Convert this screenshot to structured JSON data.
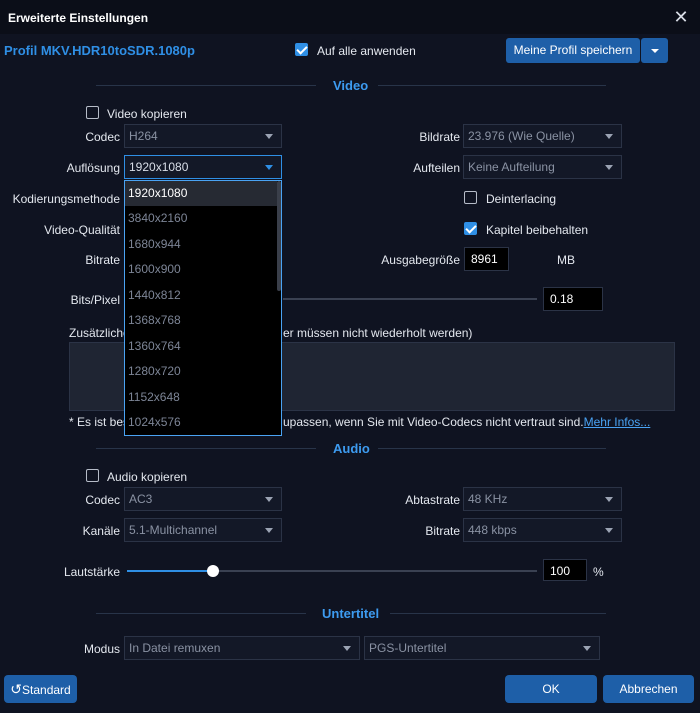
{
  "window": {
    "title": "Erweiterte Einstellungen",
    "close_glyph": "✕"
  },
  "profile": {
    "name": "Profil MKV.HDR10toSDR.1080p",
    "apply_all_label": "Auf alle anwenden",
    "apply_all_checked": true,
    "save_label": "Meine Profil speichern"
  },
  "video": {
    "section_title": "Video",
    "copy_label": "Video kopieren",
    "codec": {
      "label": "Codec",
      "value": "H264"
    },
    "resolution": {
      "label": "Auflösung",
      "value": "1920x1080",
      "options": [
        "1920x1080",
        "3840x2160",
        "1680x944",
        "1600x900",
        "1440x812",
        "1368x768",
        "1360x764",
        "1280x720",
        "1152x648",
        "1024x576"
      ],
      "selected_index": 0
    },
    "encoding_label": "Kodierungsmethode",
    "quality_label": "Video-Qualität",
    "bitrate_label": "Bitrate",
    "bits_pixel": {
      "label": "Bits/Pixel",
      "value": "0.18"
    },
    "framerate": {
      "label": "Bildrate",
      "value": "23.976 (Wie Quelle)"
    },
    "split": {
      "label": "Aufteilen",
      "value": "Keine Aufteilung"
    },
    "deinterlacing": {
      "label": "Deinterlacing",
      "checked": false
    },
    "chapters": {
      "label": "Kapitel beibehalten",
      "checked": true
    },
    "output_size": {
      "label": "Ausgabegröße",
      "value": "8961",
      "unit": "MB"
    },
    "extra_params_left": "Zusätzliche",
    "extra_params_right": "er müssen nicht wiederholt werden)",
    "note_left": "* Es ist bes",
    "note_right": "upassen, wenn Sie mit Video-Codecs nicht vertraut sind.",
    "more_info": "Mehr Infos..."
  },
  "audio": {
    "section_title": "Audio",
    "copy_label": "Audio kopieren",
    "codec": {
      "label": "Codec",
      "value": "AC3"
    },
    "channels": {
      "label": "Kanäle",
      "value": "5.1-Multichannel"
    },
    "samplerate": {
      "label": "Abtastrate",
      "value": "48 KHz"
    },
    "bitrate": {
      "label": "Bitrate",
      "value": "448 kbps"
    },
    "volume": {
      "label": "Lautstärke",
      "value": "100",
      "unit": "%",
      "level_fraction": 0.21
    }
  },
  "subtitle": {
    "section_title": "Untertitel",
    "mode": {
      "label": "Modus",
      "value": "In Datei remuxen"
    },
    "type": {
      "value": "PGS-Untertitel"
    }
  },
  "footer": {
    "default_label": "Standard",
    "ok_label": "OK",
    "cancel_label": "Abbrechen"
  },
  "colors": {
    "accent": "#2f8fe5",
    "background": "#0f1321",
    "button": "#1e5fa8"
  }
}
